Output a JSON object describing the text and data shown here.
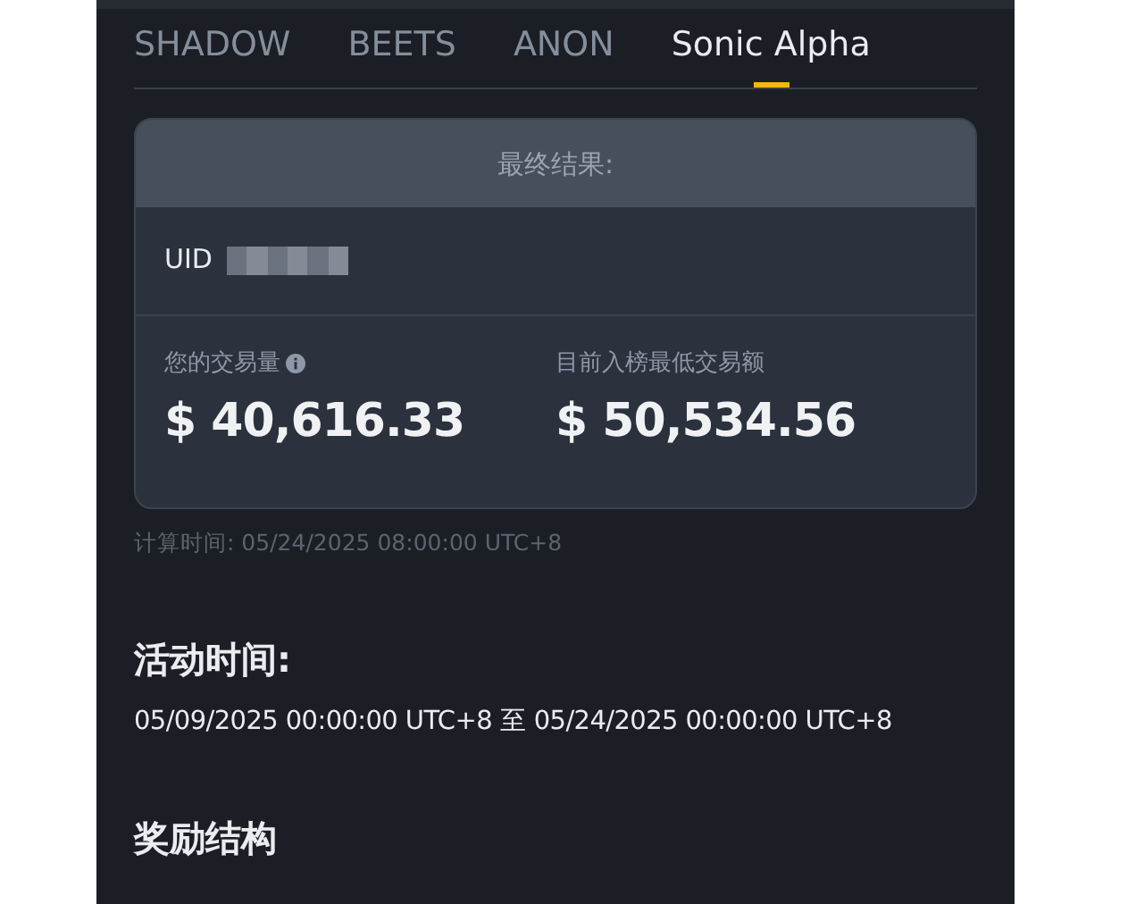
{
  "tabs": [
    {
      "label": "SHADOW",
      "selected": false
    },
    {
      "label": "BEETS",
      "selected": false
    },
    {
      "label": "ANON",
      "selected": false
    },
    {
      "label": "Sonic Alpha",
      "selected": true
    }
  ],
  "result_card": {
    "title": "最终结果:",
    "uid": {
      "label": "UID",
      "masked": true
    },
    "stats": [
      {
        "label": "您的交易量",
        "info": true,
        "value": "$ 40,616.33"
      },
      {
        "label": "目前入榜最低交易额",
        "info": false,
        "value": "$ 50,534.56"
      }
    ]
  },
  "calc_time": {
    "label": "计算时间:",
    "value": "05/24/2025 08:00:00 UTC+8"
  },
  "activity": {
    "title": "活动时间:",
    "period": "05/09/2025 00:00:00 UTC+8 至 05/24/2025 00:00:00 UTC+8"
  },
  "rewards": {
    "title": "奖励结构"
  }
}
